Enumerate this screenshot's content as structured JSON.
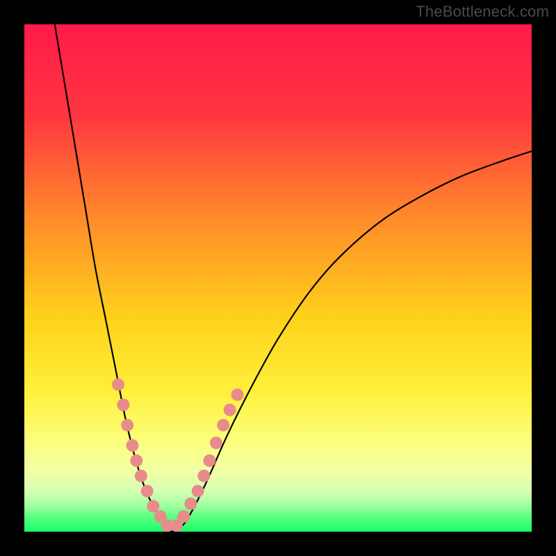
{
  "watermark": "TheBottleneck.com",
  "chart_data": {
    "type": "line",
    "title": "",
    "xlabel": "",
    "ylabel": "",
    "xlim": [
      0,
      100
    ],
    "ylim": [
      0,
      100
    ],
    "gradient_stops": [
      {
        "pct": 0,
        "color": "#ff1a4a"
      },
      {
        "pct": 18,
        "color": "#ff3640"
      },
      {
        "pct": 38,
        "color": "#ff8a2a"
      },
      {
        "pct": 58,
        "color": "#ffd21a"
      },
      {
        "pct": 72,
        "color": "#ffef3a"
      },
      {
        "pct": 82,
        "color": "#fcff7a"
      },
      {
        "pct": 88,
        "color": "#f2ffa5"
      },
      {
        "pct": 92,
        "color": "#d6ffb3"
      },
      {
        "pct": 95,
        "color": "#9eff9e"
      },
      {
        "pct": 97,
        "color": "#5cff82"
      },
      {
        "pct": 100,
        "color": "#1aff6a"
      }
    ],
    "series": [
      {
        "name": "left-curve",
        "stroke": "#000000",
        "points": [
          {
            "x": 6,
            "y": 100
          },
          {
            "x": 8,
            "y": 88
          },
          {
            "x": 10,
            "y": 76
          },
          {
            "x": 12,
            "y": 64
          },
          {
            "x": 14,
            "y": 52
          },
          {
            "x": 16,
            "y": 42
          },
          {
            "x": 18,
            "y": 32
          },
          {
            "x": 20,
            "y": 22
          },
          {
            "x": 22,
            "y": 14
          },
          {
            "x": 24,
            "y": 8
          },
          {
            "x": 26,
            "y": 4
          },
          {
            "x": 28,
            "y": 1
          },
          {
            "x": 29,
            "y": 0
          }
        ]
      },
      {
        "name": "right-curve",
        "stroke": "#000000",
        "points": [
          {
            "x": 29,
            "y": 0
          },
          {
            "x": 31,
            "y": 1
          },
          {
            "x": 33,
            "y": 4
          },
          {
            "x": 36,
            "y": 10
          },
          {
            "x": 40,
            "y": 19
          },
          {
            "x": 45,
            "y": 29
          },
          {
            "x": 50,
            "y": 38
          },
          {
            "x": 56,
            "y": 47
          },
          {
            "x": 62,
            "y": 54
          },
          {
            "x": 70,
            "y": 61
          },
          {
            "x": 78,
            "y": 66
          },
          {
            "x": 86,
            "y": 70
          },
          {
            "x": 94,
            "y": 73
          },
          {
            "x": 100,
            "y": 75
          }
        ]
      }
    ],
    "markers_left": [
      {
        "x": 18.5,
        "y": 29
      },
      {
        "x": 19.5,
        "y": 25
      },
      {
        "x": 20.3,
        "y": 21
      },
      {
        "x": 21.3,
        "y": 17
      },
      {
        "x": 22.1,
        "y": 14
      },
      {
        "x": 23.0,
        "y": 11
      },
      {
        "x": 24.2,
        "y": 8
      },
      {
        "x": 25.4,
        "y": 5
      },
      {
        "x": 26.8,
        "y": 3
      },
      {
        "x": 28.2,
        "y": 1.2
      }
    ],
    "markers_right": [
      {
        "x": 30.0,
        "y": 1.2
      },
      {
        "x": 31.4,
        "y": 3
      },
      {
        "x": 32.8,
        "y": 5.5
      },
      {
        "x": 34.2,
        "y": 8
      },
      {
        "x": 35.4,
        "y": 11
      },
      {
        "x": 36.5,
        "y": 14
      },
      {
        "x": 37.8,
        "y": 17.5
      },
      {
        "x": 39.2,
        "y": 21
      },
      {
        "x": 40.5,
        "y": 24
      },
      {
        "x": 42.0,
        "y": 27
      }
    ],
    "marker_color": "#e88b8b",
    "marker_radius_px": 9
  }
}
